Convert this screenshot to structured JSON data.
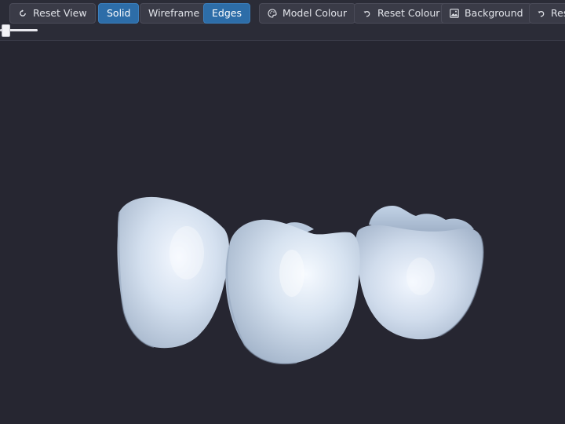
{
  "toolbar": {
    "reset_view": "Reset View",
    "solid": "Solid",
    "wireframe": "Wireframe",
    "edges": "Edges",
    "model_colour": "Model Colour",
    "reset_colour": "Reset Colour",
    "background": "Background",
    "reset_background": "Res",
    "active_modes": [
      "Solid",
      "Edges"
    ]
  },
  "slider": {
    "value_fraction": 0.1
  },
  "viewport": {
    "model": "dental crown bridge (3 teeth)",
    "model_colour": "#c4d4e7",
    "background_colour": "#262631"
  },
  "icons": {
    "reset_view": "rotate-ccw-icon",
    "model_colour": "palette-icon",
    "reset_colour": "undo-icon",
    "background": "image-icon",
    "reset_background": "undo-icon"
  }
}
